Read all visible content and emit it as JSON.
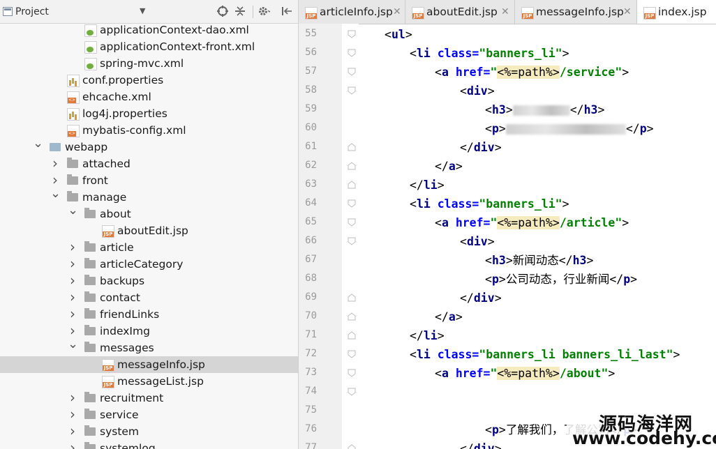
{
  "project_panel": {
    "title": "Project",
    "tree": [
      {
        "label": "applicationContext-dao.xml",
        "icon": "spring-xml-icon",
        "indent": 145,
        "arrow": ""
      },
      {
        "label": "applicationContext-front.xml",
        "icon": "spring-xml-icon",
        "indent": 145,
        "arrow": ""
      },
      {
        "label": "spring-mvc.xml",
        "icon": "spring-xml-icon",
        "indent": 145,
        "arrow": ""
      },
      {
        "label": "conf.properties",
        "icon": "properties-icon",
        "indent": 120,
        "arrow": ""
      },
      {
        "label": "ehcache.xml",
        "icon": "xml-file-icon",
        "indent": 120,
        "arrow": ""
      },
      {
        "label": "log4j.properties",
        "icon": "properties-icon",
        "indent": 120,
        "arrow": ""
      },
      {
        "label": "mybatis-config.xml",
        "icon": "xml-file-icon",
        "indent": 120,
        "arrow": ""
      },
      {
        "label": "webapp",
        "icon": "web-folder-icon",
        "indent": 95,
        "arrow": "down"
      },
      {
        "label": "attached",
        "icon": "folder-icon",
        "indent": 120,
        "arrow": "right"
      },
      {
        "label": "front",
        "icon": "folder-icon",
        "indent": 120,
        "arrow": "right"
      },
      {
        "label": "manage",
        "icon": "folder-icon",
        "indent": 120,
        "arrow": "down"
      },
      {
        "label": "about",
        "icon": "folder-icon",
        "indent": 145,
        "arrow": "down"
      },
      {
        "label": "aboutEdit.jsp",
        "icon": "jsp-file-icon",
        "indent": 170,
        "arrow": ""
      },
      {
        "label": "article",
        "icon": "folder-icon",
        "indent": 145,
        "arrow": "right"
      },
      {
        "label": "articleCategory",
        "icon": "folder-icon",
        "indent": 145,
        "arrow": "right"
      },
      {
        "label": "backups",
        "icon": "folder-icon",
        "indent": 145,
        "arrow": "right"
      },
      {
        "label": "contact",
        "icon": "folder-icon",
        "indent": 145,
        "arrow": "right"
      },
      {
        "label": "friendLinks",
        "icon": "folder-icon",
        "indent": 145,
        "arrow": "right"
      },
      {
        "label": "indexImg",
        "icon": "folder-icon",
        "indent": 145,
        "arrow": "right"
      },
      {
        "label": "messages",
        "icon": "folder-icon",
        "indent": 145,
        "arrow": "down"
      },
      {
        "label": "messageInfo.jsp",
        "icon": "jsp-file-icon",
        "indent": 170,
        "arrow": "",
        "selected": true
      },
      {
        "label": "messageList.jsp",
        "icon": "jsp-file-icon",
        "indent": 170,
        "arrow": ""
      },
      {
        "label": "recruitment",
        "icon": "folder-icon",
        "indent": 145,
        "arrow": "right"
      },
      {
        "label": "service",
        "icon": "folder-icon",
        "indent": 145,
        "arrow": "right"
      },
      {
        "label": "system",
        "icon": "folder-icon",
        "indent": 145,
        "arrow": "right"
      },
      {
        "label": "systemlog",
        "icon": "folder-icon",
        "indent": 145,
        "arrow": "right"
      }
    ]
  },
  "tabs": [
    {
      "label": "articleInfo.jsp",
      "active": false
    },
    {
      "label": "aboutEdit.jsp",
      "active": false
    },
    {
      "label": "messageInfo.jsp",
      "active": false
    },
    {
      "label": "index.jsp",
      "active": true
    }
  ],
  "editor": {
    "line_numbers": [
      "55",
      "56",
      "57",
      "58",
      "59",
      "60",
      "61",
      "62",
      "63",
      "64",
      "65",
      "66",
      "67",
      "68",
      "69",
      "70",
      "71",
      "72",
      "73",
      "74",
      "75",
      "76",
      "77"
    ],
    "texts": {
      "li_class": "banners_li",
      "li_class_last": "banners_li banners_li_last",
      "href_service": "/service",
      "href_article": "/article",
      "href_about": "/about",
      "h3_news": "新闻动态",
      "p_news": "公司动态，行业新闻",
      "p_about": "了解我们，了解公司"
    }
  },
  "watermark": {
    "line1": "源码海洋网",
    "line2": "www.codehy.com"
  }
}
